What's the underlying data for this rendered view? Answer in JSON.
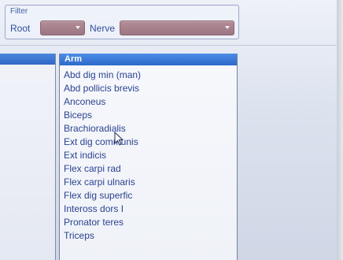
{
  "filter": {
    "title": "Filter",
    "root_label": "Root",
    "nerve_label": "Nerve",
    "root_value": "",
    "nerve_value": ""
  },
  "muscle_list": {
    "header": "Arm",
    "items": [
      "Abd dig min (man)",
      "Abd pollicis brevis",
      "Anconeus",
      "Biceps",
      "Brachioradialis",
      "Ext dig communis",
      "Ext indicis",
      "Flex carpi rad",
      "Flex carpi ulnaris",
      "Flex dig superfic",
      "Inteross dors I",
      "Pronator teres",
      "Triceps"
    ]
  },
  "icons": {
    "dropdown": "chevron-down-icon",
    "pointer": "mouse-pointer-icon"
  },
  "colors": {
    "selection": "#2f67c6",
    "text": "#2b438f",
    "combo": "#9c7682"
  }
}
